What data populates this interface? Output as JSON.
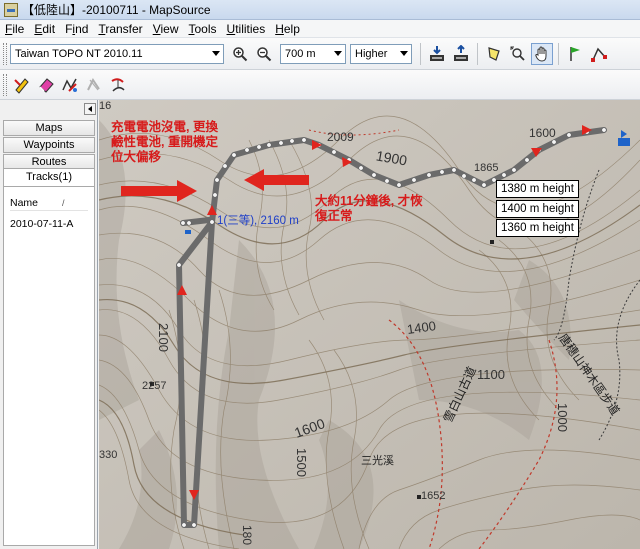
{
  "window": {
    "title": "【低陸山】-20100711 - MapSource"
  },
  "menu": [
    {
      "label": "File",
      "mnemonic": "F",
      "rest": "ile"
    },
    {
      "label": "Edit",
      "mnemonic": "E",
      "rest": "dit"
    },
    {
      "label": "Find",
      "mnemonic": "i",
      "pre": "F",
      "rest": "nd"
    },
    {
      "label": "Transfer",
      "mnemonic": "T",
      "rest": "ransfer"
    },
    {
      "label": "View",
      "mnemonic": "V",
      "rest": "iew"
    },
    {
      "label": "Tools",
      "mnemonic": "T",
      "rest": "ools"
    },
    {
      "label": "Utilities",
      "mnemonic": "U",
      "rest": "tilities"
    },
    {
      "label": "Help",
      "mnemonic": "H",
      "rest": "elp"
    }
  ],
  "toolbar": {
    "map_product": "Taiwan TOPO NT 2010.11",
    "zoom_level": "700 m",
    "detail_level": "Higher"
  },
  "sidebar": {
    "tabs": [
      "Maps",
      "Waypoints",
      "Routes"
    ],
    "active_tab": "Tracks(1)",
    "list_header": "Name",
    "list_sort_indicator": "/",
    "tracks": [
      "2010-07-11-A"
    ]
  },
  "map": {
    "callouts": [
      "1380 m height",
      "1400 m height",
      "1360 m height"
    ],
    "annotations": {
      "battery_note": "充電電池沒電, 更換\n鹼性電池, 重開機定\n位大偏移",
      "recovery_note": "大約11分鐘後, 才恢\n復正常"
    },
    "summit_label": "1(三等), 2160 m",
    "contour_labels": [
      "2009",
      "1900",
      "1600",
      "1865",
      "1400",
      "1100",
      "1000",
      "2100",
      "1600",
      "1500",
      "1652",
      "2257",
      "330",
      "180",
      "16"
    ],
    "place_labels": [
      "三光溪",
      "雪白山古道",
      "唐穗山神木區步道"
    ],
    "colors": {
      "track": "#6b6b6b",
      "track_point": "#f4f4f4",
      "direction_arrow": "#e0251e",
      "annotation_text": "#d71b1b",
      "terrain_base": "#c6c1b8",
      "contour": "#8a7a63",
      "summit_label": "#1f3fc8"
    }
  }
}
